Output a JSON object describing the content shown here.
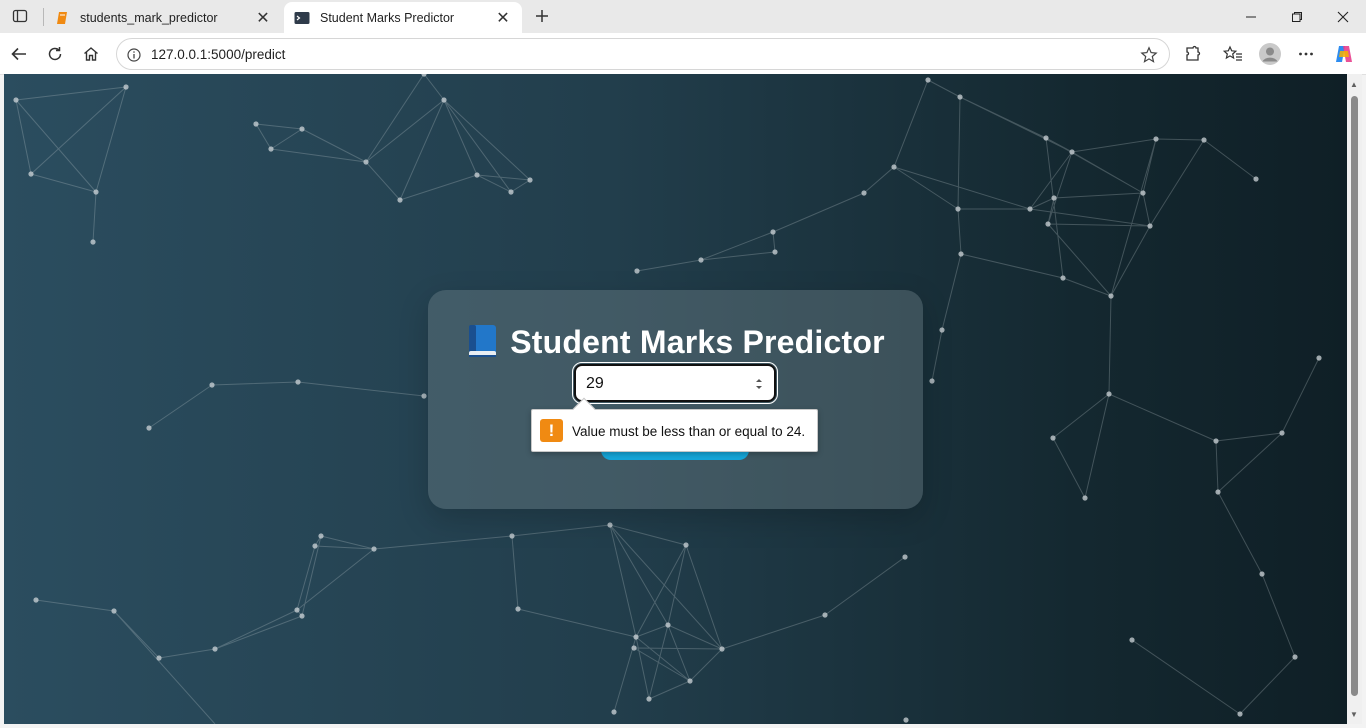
{
  "browser": {
    "tabs": [
      {
        "title": "students_mark_predictor",
        "favicon": "orange-notebook-icon",
        "active": false
      },
      {
        "title": "Student Marks Predictor",
        "favicon": "terminal-icon",
        "active": true
      }
    ],
    "url": "127.0.0.1:5000/predict"
  },
  "page": {
    "title": "Student Marks Predictor",
    "title_icon": "blue-book-icon",
    "input_value": "29",
    "validation_message": "Value must be less than or equal to 24.",
    "button_color": "#16a6d9",
    "background_colors": [
      "#2b4d5f",
      "#0f1f26"
    ]
  }
}
